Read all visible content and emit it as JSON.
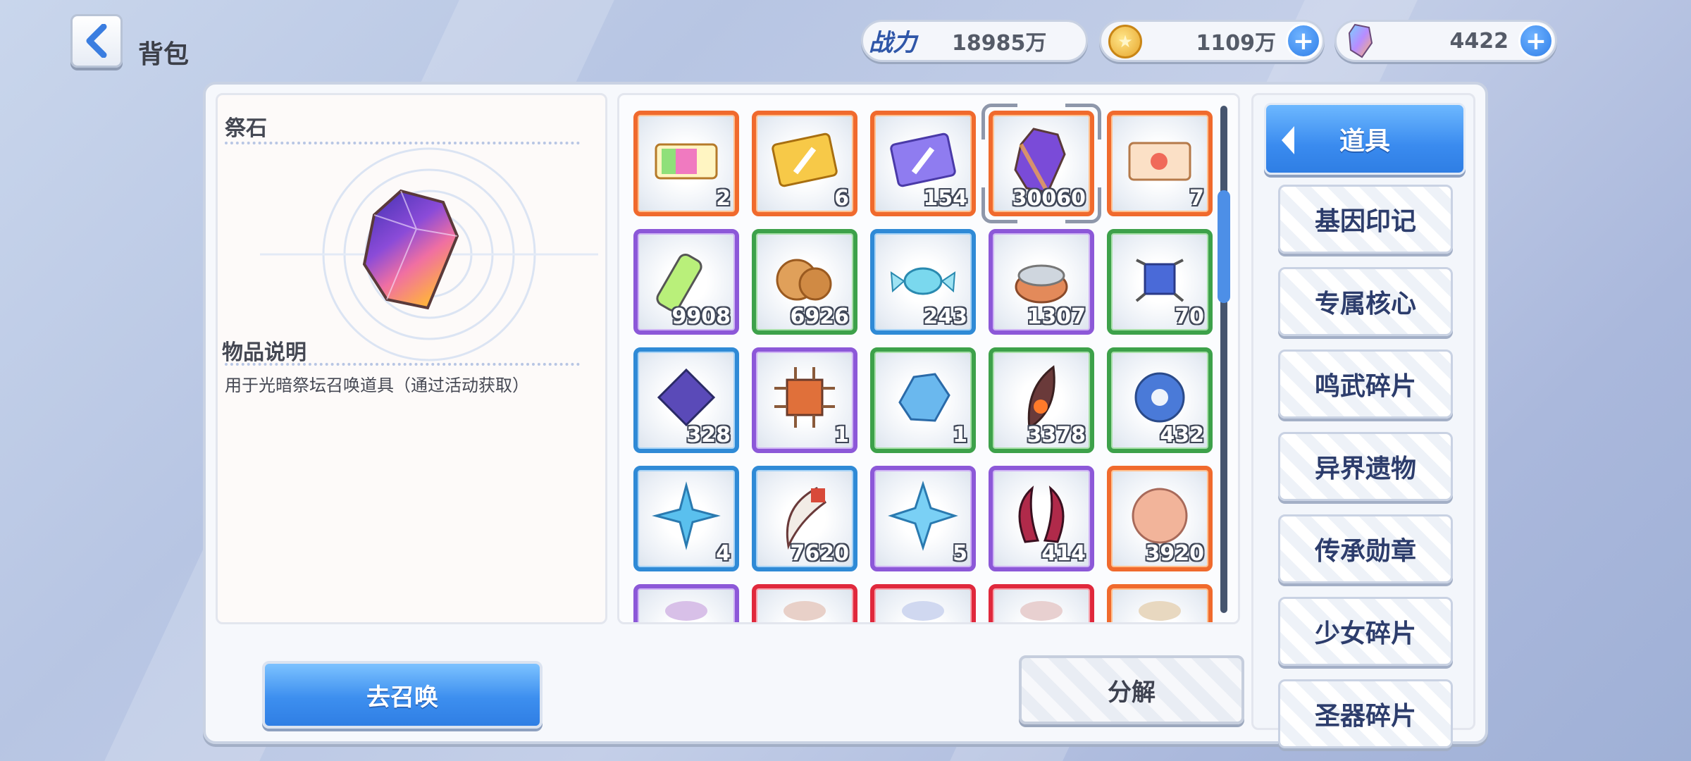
{
  "header": {
    "back_label": "背包",
    "power_label": "战力",
    "power_value": "18985万",
    "gold_value": "1109万",
    "gem_value": "4422",
    "plus_symbol": "+"
  },
  "detail": {
    "item_name": "祭石",
    "desc_title": "物品说明",
    "desc_text": "用于光暗祭坛召唤道具（通过活动获取）"
  },
  "buttons": {
    "summon": "去召唤",
    "decompose": "分解"
  },
  "categories": {
    "active": "道具",
    "items": [
      "基因印记",
      "专属核心",
      "鸣武碎片",
      "异界遗物",
      "传承勋章",
      "少女碎片",
      "圣器碎片"
    ]
  },
  "grid": {
    "items": [
      {
        "name": "rainbow-ticket",
        "qty": "2",
        "rarity": "orange"
      },
      {
        "name": "gold-sword-ticket",
        "qty": "6",
        "rarity": "orange"
      },
      {
        "name": "purple-sword-ticket",
        "qty": "154",
        "rarity": "orange"
      },
      {
        "name": "prism-stone",
        "qty": "30060",
        "rarity": "orange",
        "selected": true
      },
      {
        "name": "crab-ticket",
        "qty": "7",
        "rarity": "orange"
      },
      {
        "name": "green-battery",
        "qty": "9908",
        "rarity": "purple"
      },
      {
        "name": "cookies",
        "qty": "6926",
        "rarity": "green"
      },
      {
        "name": "candy",
        "qty": "243",
        "rarity": "blue"
      },
      {
        "name": "canned-food",
        "qty": "1307",
        "rarity": "purple"
      },
      {
        "name": "blue-chip-small",
        "qty": "70",
        "rarity": "green"
      },
      {
        "name": "purple-chip",
        "qty": "328",
        "rarity": "blue"
      },
      {
        "name": "cpu-chip",
        "qty": "1",
        "rarity": "purple"
      },
      {
        "name": "blue-crystal",
        "qty": "1",
        "rarity": "green"
      },
      {
        "name": "flame-feather",
        "qty": "3378",
        "rarity": "green"
      },
      {
        "name": "gear",
        "qty": "432",
        "rarity": "green"
      },
      {
        "name": "ice-star-small",
        "qty": "4",
        "rarity": "blue"
      },
      {
        "name": "fang",
        "qty": "7620",
        "rarity": "blue"
      },
      {
        "name": "ice-star",
        "qty": "5",
        "rarity": "purple"
      },
      {
        "name": "crimson-horns",
        "qty": "414",
        "rarity": "purple"
      },
      {
        "name": "bronze-coin",
        "qty": "3920",
        "rarity": "orange"
      },
      {
        "name": "partial-item-1",
        "qty": "",
        "rarity": "purple"
      },
      {
        "name": "partial-item-2",
        "qty": "",
        "rarity": "red"
      },
      {
        "name": "partial-item-3",
        "qty": "",
        "rarity": "red"
      },
      {
        "name": "partial-item-4",
        "qty": "",
        "rarity": "red"
      },
      {
        "name": "partial-item-5",
        "qty": "",
        "rarity": "orange"
      }
    ]
  },
  "colors": {
    "accent_blue": "#3d8fef",
    "rarity_orange": "#f06a2d",
    "rarity_purple": "#8c58d8",
    "rarity_green": "#3da14a",
    "rarity_blue": "#2f8ad6",
    "rarity_red": "#e0283c"
  }
}
